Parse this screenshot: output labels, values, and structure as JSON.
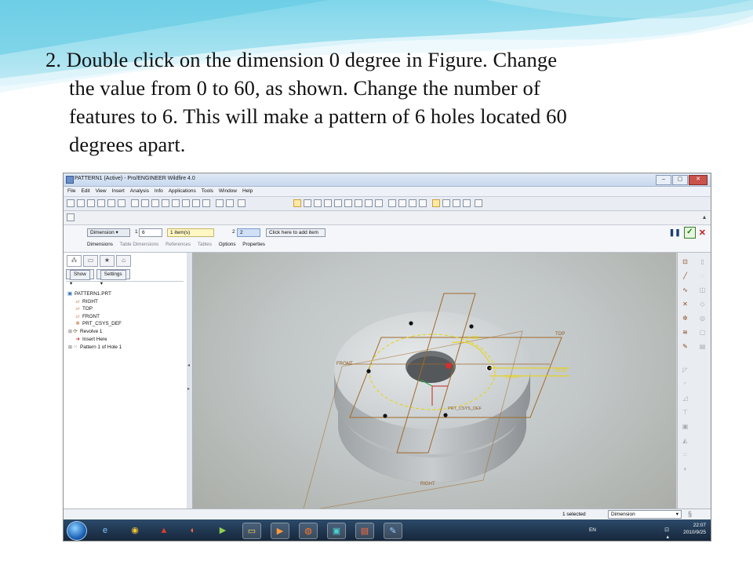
{
  "slide": {
    "lines": [
      "2. Double click on the dimension 0 degree in Figure.  Change",
      "the value from 0 to 60, as shown.  Change the number of",
      "features to 6.  This will make a pattern of 6 holes located 60",
      "degrees apart."
    ]
  },
  "window": {
    "title": "PATTERN1 (Active) - Pro/ENGINEER Wildfire 4.0",
    "buttons": {
      "minimize": "–",
      "maximize": "▢",
      "close": "✕"
    }
  },
  "menu": {
    "items": [
      "File",
      "Edit",
      "View",
      "Insert",
      "Analysis",
      "Info",
      "Applications",
      "Tools",
      "Window",
      "Help"
    ]
  },
  "dashboard": {
    "direction1_type": "Dimension",
    "direction1_number": "1",
    "direction1_count": "6",
    "direction1_items": "1 item(s)",
    "direction2_number": "2",
    "direction2_count": "2",
    "direction2_add": "Click here to add item",
    "tabs": [
      "Dimensions",
      "Table Dimensions",
      "References",
      "Tables",
      "Options",
      "Properties"
    ],
    "pause_icon": "pause-icon",
    "accept_icon": "check-icon",
    "cancel_icon": "cancel-icon"
  },
  "navigator": {
    "show_label": "Show",
    "settings_label": "Settings",
    "tree": [
      {
        "label": "PATTERN1.PRT",
        "icon": "part-icon"
      },
      {
        "label": "RIGHT",
        "icon": "datum-plane-icon"
      },
      {
        "label": "TOP",
        "icon": "datum-plane-icon"
      },
      {
        "label": "FRONT",
        "icon": "datum-plane-icon"
      },
      {
        "label": "PRT_CSYS_DEF",
        "icon": "csys-icon"
      },
      {
        "label": "Revolve 1",
        "icon": "revolve-icon"
      },
      {
        "label": "Insert Here",
        "icon": "insert-arrow-icon"
      },
      {
        "label": "Pattern 1 of Hole 1",
        "icon": "pattern-icon"
      }
    ]
  },
  "model": {
    "label_front": "FRONT",
    "label_top": "TOP",
    "label_csys": "PRT_CSYS_DEF",
    "label_right": "RIGHT",
    "dim_angle": "25.000",
    "dim_right": "25.00",
    "dim_mid": "20.000"
  },
  "status": {
    "selected": "1 selected",
    "filter": "Dimension"
  },
  "taskbar": {
    "language": "EN",
    "time": "22:07",
    "date": "2010/9/25"
  }
}
